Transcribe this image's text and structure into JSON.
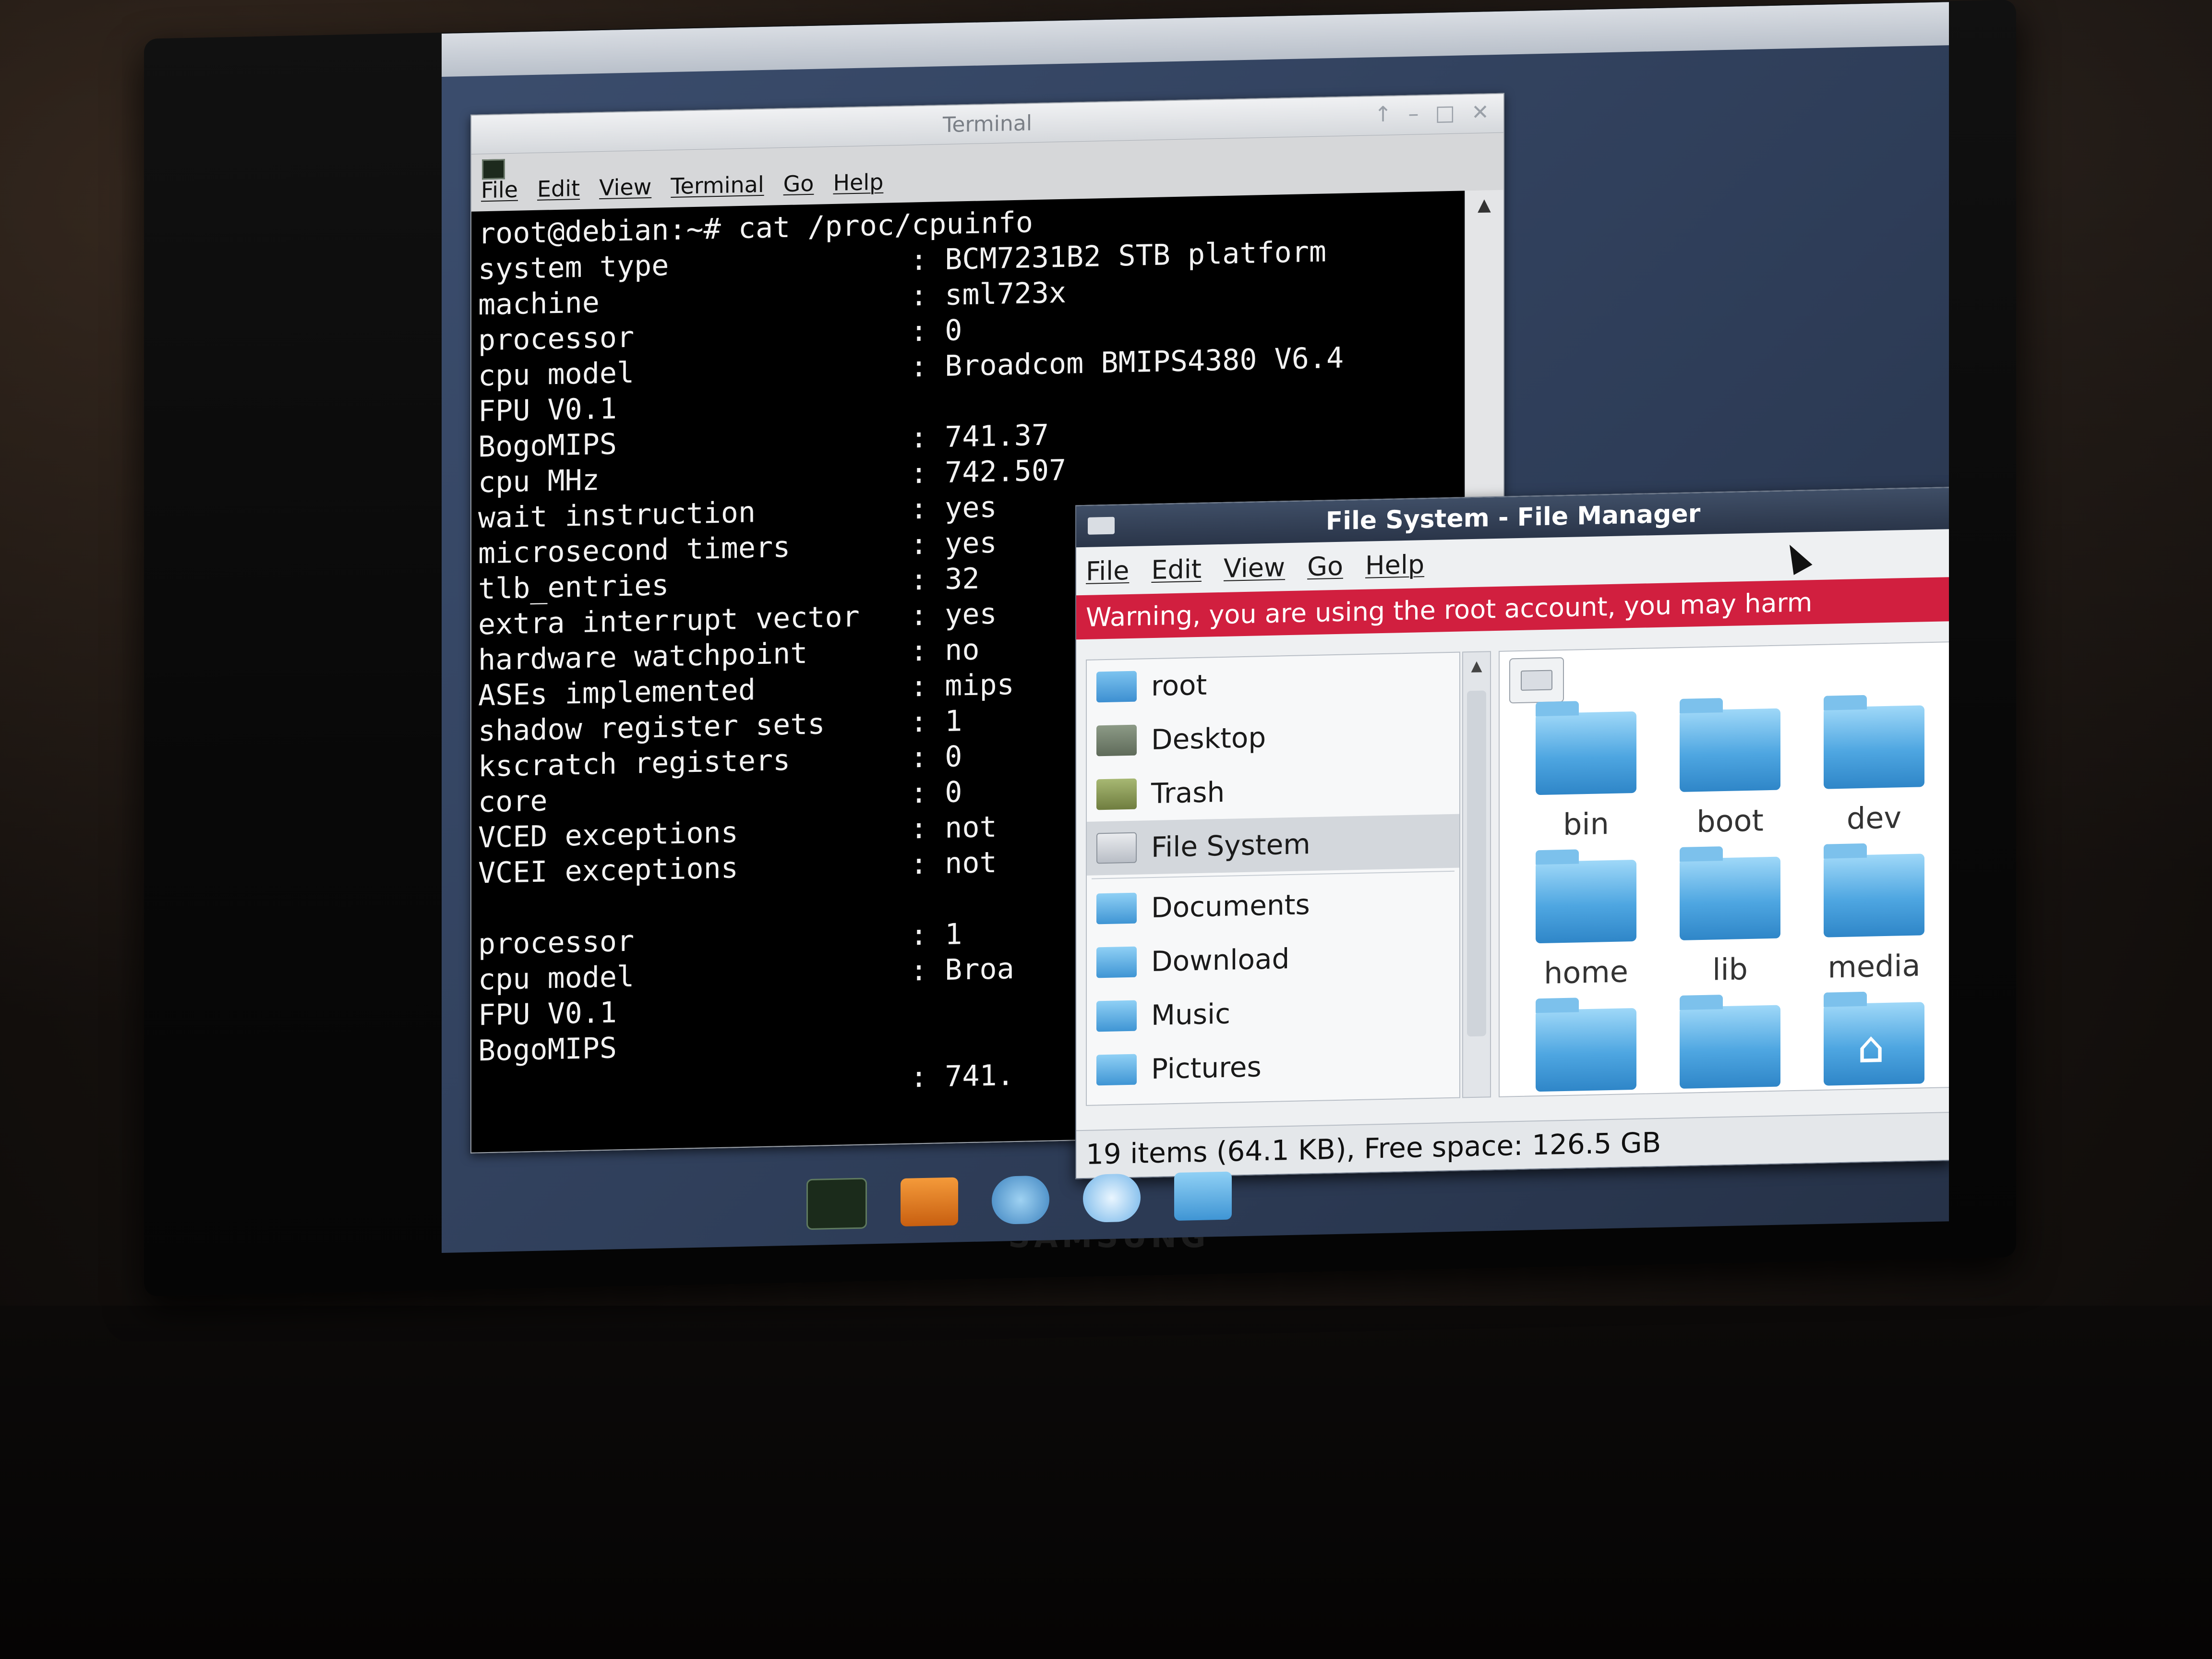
{
  "tv": {
    "brand": "SAMSUNG"
  },
  "terminal": {
    "title": "Terminal",
    "menu": [
      "File",
      "Edit",
      "View",
      "Terminal",
      "Go",
      "Help"
    ],
    "prompt": "root@debian:~# cat /proc/cpuinfo",
    "lines": [
      {
        "key": "system type",
        "value": ": BCM7231B2 STB platform"
      },
      {
        "key": "machine",
        "value": ": sml723x"
      },
      {
        "key": "processor",
        "value": ": 0"
      },
      {
        "key": "cpu model",
        "value": ": Broadcom BMIPS4380 V6.4"
      },
      {
        "key": "FPU V0.1",
        "value": ""
      },
      {
        "key": "BogoMIPS",
        "value": ": 741.37"
      },
      {
        "key": "cpu MHz",
        "value": ": 742.507"
      },
      {
        "key": "wait instruction",
        "value": ": yes"
      },
      {
        "key": "microsecond timers",
        "value": ": yes"
      },
      {
        "key": "tlb_entries",
        "value": ": 32"
      },
      {
        "key": "extra interrupt vector",
        "value": ": yes"
      },
      {
        "key": "hardware watchpoint",
        "value": ": no"
      },
      {
        "key": "ASEs implemented",
        "value": ": mips"
      },
      {
        "key": "shadow register sets",
        "value": ": 1"
      },
      {
        "key": "kscratch registers",
        "value": ": 0"
      },
      {
        "key": "core",
        "value": ": 0"
      },
      {
        "key": "VCED exceptions",
        "value": ": not"
      },
      {
        "key": "VCEI exceptions",
        "value": ": not"
      }
    ],
    "lines2": [
      {
        "key": "processor",
        "value": ": 1"
      },
      {
        "key": "cpu model",
        "value": ": Broa"
      },
      {
        "key": "FPU V0.1",
        "value": ""
      },
      {
        "key": "BogoMIPS",
        "value": ""
      },
      {
        "key": "",
        "value": ": 741."
      }
    ]
  },
  "file_manager": {
    "title": "File System - File Manager",
    "menu": [
      "File",
      "Edit",
      "View",
      "Go",
      "Help"
    ],
    "warning": "Warning, you are using the root account, you may harm",
    "warning_color": "#d11f3f",
    "places": [
      {
        "label": "root",
        "icon": "home-folder-icon"
      },
      {
        "label": "Desktop",
        "icon": "desktop-icon"
      },
      {
        "label": "Trash",
        "icon": "trash-icon"
      },
      {
        "label": "File System",
        "icon": "drive-icon",
        "selected": true
      }
    ],
    "bookmarks": [
      {
        "label": "Documents",
        "icon": "folder-icon"
      },
      {
        "label": "Download",
        "icon": "folder-icon"
      },
      {
        "label": "Music",
        "icon": "folder-icon"
      },
      {
        "label": "Pictures",
        "icon": "folder-icon"
      }
    ],
    "folders": [
      "bin",
      "boot",
      "dev",
      "home",
      "lib",
      "media"
    ],
    "status": "19 items (64.1 KB), Free space: 126.5 GB"
  }
}
